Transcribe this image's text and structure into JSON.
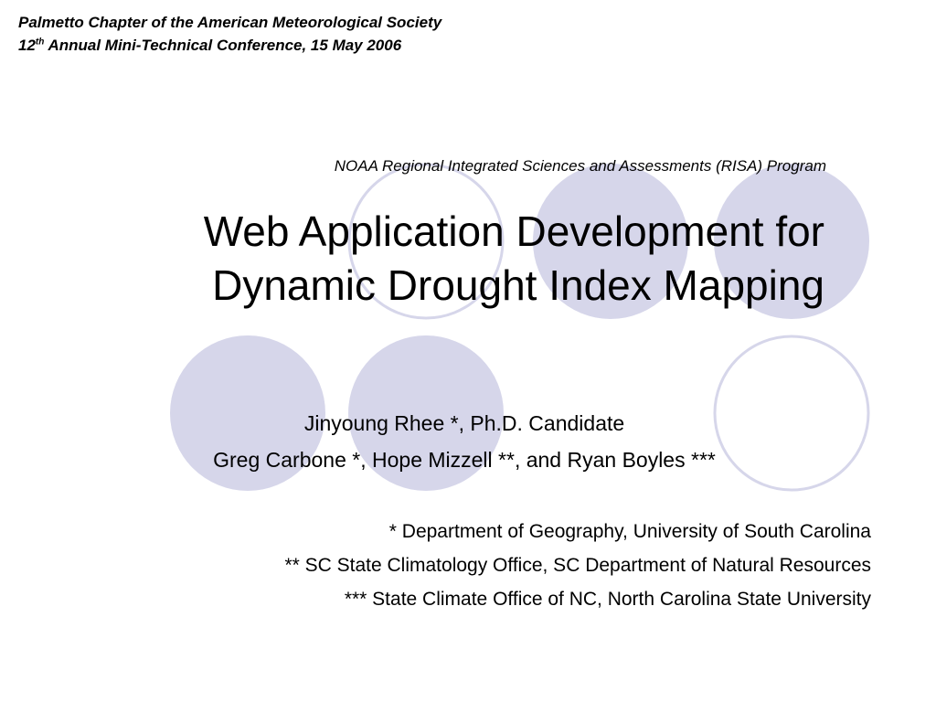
{
  "slide": {
    "header": {
      "line1": "Palmetto Chapter of the American Meteorological Society",
      "line2_num": "12",
      "line2_sup": "th",
      "line2_rest": " Annual Mini-Technical Conference, 15 May 2006"
    },
    "program": "NOAA Regional Integrated Sciences and Assessments (RISA) Program",
    "title": {
      "line1": "Web Application Development for",
      "line2": "Dynamic Drought Index Mapping"
    },
    "authors": [
      "Jinyoung Rhee *, Ph.D. Candidate",
      "Greg Carbone *, Hope Mizzell **, and Ryan Boyles ***"
    ],
    "affiliations": [
      "* Department of Geography, University of South Carolina",
      "** SC State Climatology Office, SC Department of Natural Resources",
      "*** State Climate Office of NC, North Carolina State University"
    ]
  },
  "colors": {
    "circle_fill": "#d6d6ea",
    "circle_stroke": "#d6d6ea",
    "text": "#000000"
  }
}
